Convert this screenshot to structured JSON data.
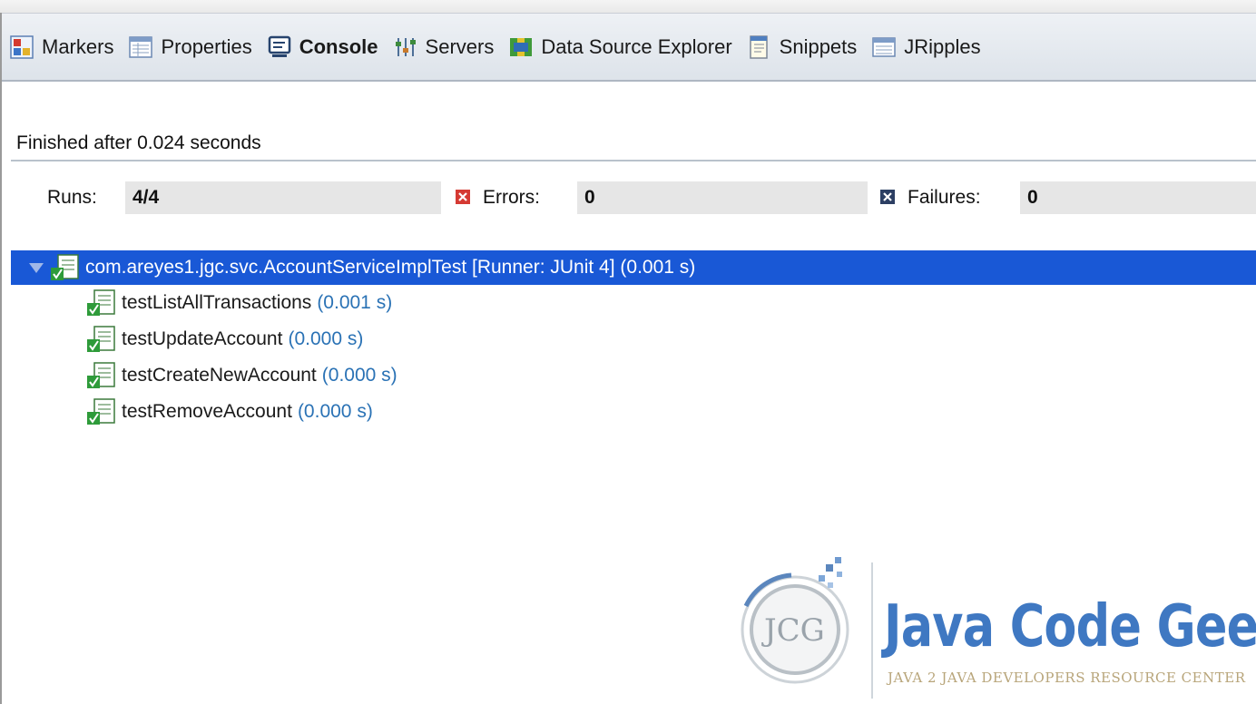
{
  "tabs": [
    {
      "label": "Markers",
      "icon": "markers-icon",
      "active": false
    },
    {
      "label": "Properties",
      "icon": "properties-icon",
      "active": false
    },
    {
      "label": "Console",
      "icon": "console-icon",
      "active": true
    },
    {
      "label": "Servers",
      "icon": "servers-icon",
      "active": false
    },
    {
      "label": "Data Source Explorer",
      "icon": "data-source-explorer-icon",
      "active": false
    },
    {
      "label": "Snippets",
      "icon": "snippets-icon",
      "active": false
    },
    {
      "label": "JRipples",
      "icon": "jripples-icon",
      "active": false
    }
  ],
  "status": "Finished after 0.024 seconds",
  "counters": {
    "runs_label": "Runs:",
    "runs_value": "4/4",
    "errors_label": "Errors:",
    "errors_value": "0",
    "failures_label": "Failures:",
    "failures_value": "0"
  },
  "tree": {
    "root": "com.areyes1.jgc.svc.AccountServiceImplTest [Runner: JUnit 4] (0.001 s)",
    "children": [
      {
        "name": "testListAllTransactions",
        "time": "(0.001 s)"
      },
      {
        "name": "testUpdateAccount",
        "time": "(0.000 s)"
      },
      {
        "name": "testCreateNewAccount",
        "time": "(0.000 s)"
      },
      {
        "name": "testRemoveAccount",
        "time": "(0.000 s)"
      }
    ]
  },
  "watermark": {
    "brand": "Java Code Geeks",
    "tagline": "JAVA 2 JAVA DEVELOPERS RESOURCE CENTER",
    "mark": "JCG"
  },
  "colors": {
    "selection": "#1958d6",
    "time_text": "#2a72b5",
    "brand": "#3f78c2"
  }
}
